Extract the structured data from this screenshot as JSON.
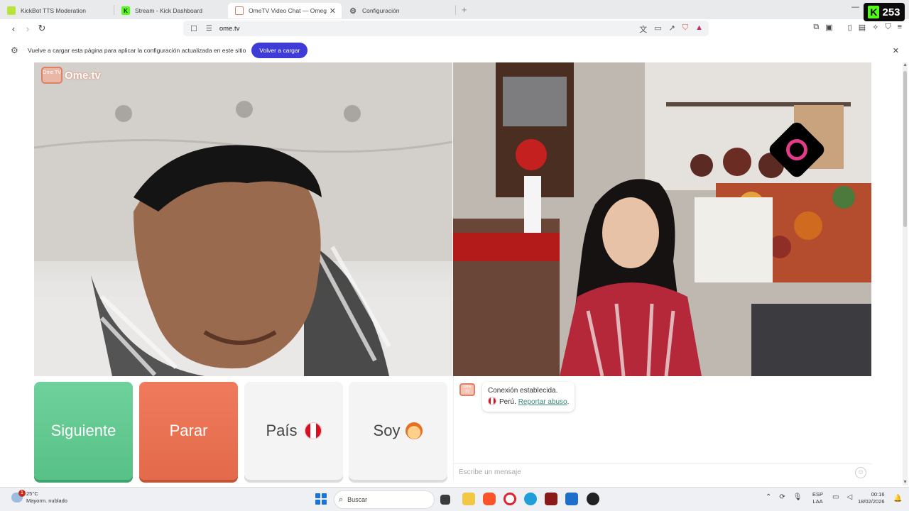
{
  "tabs": [
    {
      "title": "KickBot TTS Moderation",
      "icon": "leaf-icon",
      "color": "#b9e43a"
    },
    {
      "title": "Stream - Kick Dashboard",
      "icon": "kick-icon",
      "color": "#53fc18"
    },
    {
      "title": "OmeTV Video Chat — Omeg",
      "icon": "ometv-icon",
      "color": "#e07f63",
      "active": true
    },
    {
      "title": "Configuración",
      "icon": "gear-icon"
    }
  ],
  "kick_badge": {
    "count": "253",
    "letter": "K"
  },
  "address": {
    "url": "ome.tv"
  },
  "notice": {
    "text": "Vuelve a cargar esta página para aplicar la configuración actualizada en este sitio",
    "button": "Volver a cargar"
  },
  "logo": {
    "small": "Ome TV",
    "text": "Ome.tv"
  },
  "buttons": {
    "next": "Siguiente",
    "stop": "Parar",
    "country": "País",
    "gender": "Soy"
  },
  "chat": {
    "logo": "Ome TV",
    "status": "Conexión establecida.",
    "country": "Perú.",
    "report": "Reportar abuso",
    "report_suffix": ".",
    "placeholder": "Escribe un mensaje"
  },
  "taskbar": {
    "notification_count": "1",
    "temperature": "25°C",
    "weather": "Mayorm. nublado",
    "search": "Buscar",
    "lang_top": "ESP",
    "lang_bottom": "LAA",
    "time": "00:16",
    "date": "18/02/2026"
  },
  "colors": {
    "accent": "#3f3bd6",
    "next": "#5dc98e",
    "stop": "#e8704f"
  }
}
